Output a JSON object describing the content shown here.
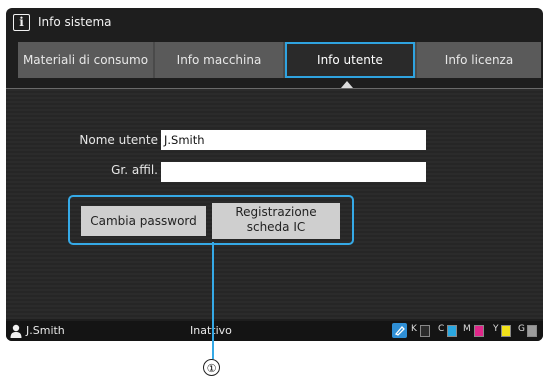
{
  "window": {
    "title": "Info sistema",
    "icon": "info-icon"
  },
  "tabs": [
    {
      "label": "Materiali di consumo",
      "active": false
    },
    {
      "label": "Info macchina",
      "active": false
    },
    {
      "label": "Info utente",
      "active": true
    },
    {
      "label": "Info licenza",
      "active": false
    }
  ],
  "form": {
    "user_name_label": "Nome utente",
    "user_name_value": "J.Smith",
    "group_label": "Gr. affil.",
    "group_value": ""
  },
  "buttons": {
    "change_password": "Cambia password",
    "ic_card_line1": "Registrazione",
    "ic_card_line2": "scheda IC"
  },
  "status": {
    "user": "J.Smith",
    "state": "Inattivo",
    "toner": [
      {
        "label": "K",
        "color": "#2b2b2b"
      },
      {
        "label": "C",
        "color": "#2aa7e0"
      },
      {
        "label": "M",
        "color": "#e0278a"
      },
      {
        "label": "Y",
        "color": "#f2e21a"
      },
      {
        "label": "G",
        "color": "#9a9a9a"
      }
    ]
  },
  "callout": "①",
  "colors": {
    "accent": "#35a9e6",
    "background": "#1e1e1e"
  }
}
